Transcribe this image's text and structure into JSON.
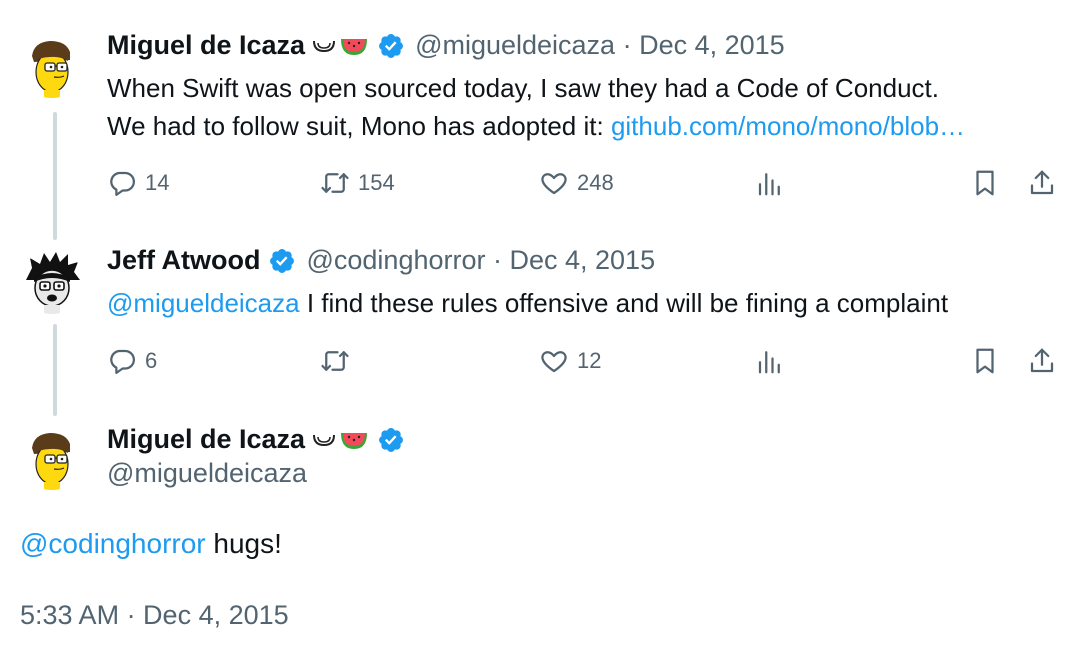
{
  "tweet1": {
    "name": "Miguel de Icaza",
    "handle": "@migueldeicaza",
    "date": "Dec 4, 2015",
    "text_line1": "When Swift was open sourced today, I saw they had a Code of Conduct.",
    "text_line2_prefix": "We had to follow suit, Mono has adopted it: ",
    "link": "github.com/mono/mono/blob…",
    "replies": "14",
    "reposts": "154",
    "likes": "248"
  },
  "tweet2": {
    "name": "Jeff Atwood",
    "handle": "@codinghorror",
    "date": "Dec 4, 2015",
    "mention": "@migueldeicaza",
    "text": " I find these rules offensive and will be fining a complaint",
    "replies": "6",
    "reposts": "",
    "likes": "12"
  },
  "main_tweet": {
    "name": "Miguel de Icaza",
    "handle": "@migueldeicaza",
    "mention": "@codinghorror",
    "text": " hugs!",
    "timestamp": "5:33 AM · Dec 4, 2015"
  },
  "separator": " · ",
  "colors": {
    "link": "#1d9bf0",
    "secondary_text": "#536471",
    "primary_text": "#0f1419",
    "thread_line": "#cfd9de",
    "verified": "#1d9bf0"
  },
  "icons": [
    "reply-icon",
    "repost-icon",
    "like-icon",
    "views-icon",
    "bookmark-icon",
    "share-icon",
    "verified-icon",
    "melon-emoji",
    "watermelon-emoji"
  ]
}
